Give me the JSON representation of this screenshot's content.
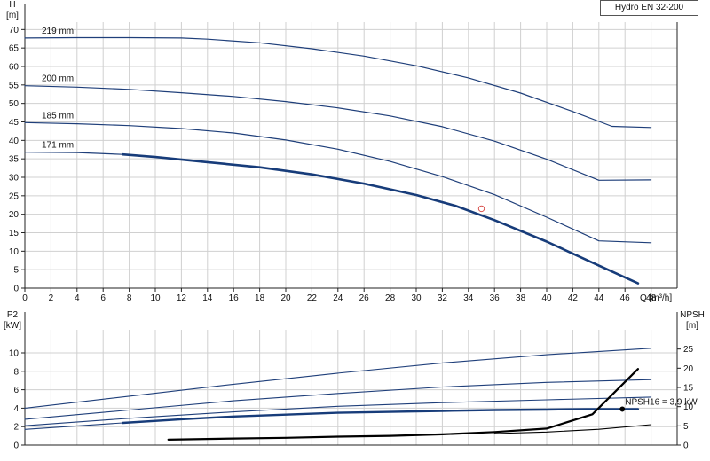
{
  "title": "Hydro EN 32-200",
  "chart_data": [
    {
      "type": "line",
      "xlabel": "Q [m³/h]",
      "ylabel_line1": "H",
      "ylabel_line2": "[m]",
      "xlim": [
        0,
        50
      ],
      "ylim": [
        0,
        72
      ],
      "xticks": [
        0,
        2,
        4,
        6,
        8,
        10,
        12,
        14,
        16,
        18,
        20,
        22,
        24,
        26,
        28,
        30,
        32,
        34,
        36,
        38,
        40,
        42,
        44,
        46,
        48
      ],
      "yticks": [
        0,
        5,
        10,
        15,
        20,
        25,
        30,
        35,
        40,
        45,
        50,
        55,
        60,
        65,
        70
      ],
      "grid": true,
      "series": [
        {
          "name": "219 mm",
          "color": "#1f3f7a",
          "width": 1.2,
          "x": [
            0,
            4,
            8,
            12,
            14,
            18,
            22,
            26,
            30,
            34,
            38,
            42,
            45,
            48
          ],
          "y": [
            67.7,
            67.8,
            67.8,
            67.7,
            67.4,
            66.4,
            64.8,
            62.8,
            60.2,
            56.9,
            52.8,
            47.8,
            43.8,
            43.5
          ]
        },
        {
          "name": "200 mm",
          "color": "#1f3f7a",
          "width": 1.2,
          "x": [
            0,
            4,
            8,
            12,
            16,
            20,
            24,
            28,
            32,
            36,
            40,
            44,
            48
          ],
          "y": [
            54.8,
            54.4,
            53.8,
            52.9,
            51.9,
            50.5,
            48.8,
            46.6,
            43.7,
            39.8,
            34.9,
            29.2,
            29.3
          ]
        },
        {
          "name": "185 mm",
          "color": "#1f3f7a",
          "width": 1.2,
          "x": [
            0,
            4,
            8,
            12,
            16,
            20,
            24,
            28,
            32,
            36,
            40,
            44,
            48
          ],
          "y": [
            44.8,
            44.5,
            44.0,
            43.2,
            42.0,
            40.1,
            37.6,
            34.3,
            30.2,
            25.3,
            19.2,
            12.8,
            12.3
          ]
        },
        {
          "name": "171 mm",
          "color": "#1f3f7a",
          "width": 1.2,
          "x": [
            0,
            4,
            7.5
          ],
          "y": [
            36.8,
            36.7,
            36.2
          ]
        },
        {
          "name": "171 mm duty",
          "color": "#173c7a",
          "width": 2.6,
          "x": [
            7.5,
            10,
            14,
            18,
            22,
            26,
            30,
            33,
            36,
            40,
            44,
            47
          ],
          "y": [
            36.2,
            35.5,
            34.1,
            32.7,
            30.8,
            28.3,
            25.2,
            22.3,
            18.4,
            12.6,
            6.1,
            1.3
          ]
        }
      ],
      "point": {
        "x": 35,
        "y": 21.5,
        "color": "#d9534f"
      }
    },
    {
      "type": "line",
      "ylabel_left_line1": "P2",
      "ylabel_left_line2": "[kW]",
      "ylabel_right_line1": "NPSH",
      "ylabel_right_line2": "[m]",
      "xlim": [
        0,
        50
      ],
      "ylim_left": [
        0,
        12.5
      ],
      "ylim_right": [
        0,
        30
      ],
      "yticks_left": [
        0,
        2,
        4,
        6,
        8,
        10
      ],
      "yticks_right": [
        0,
        5,
        10,
        15,
        20,
        25
      ],
      "grid": true,
      "series": [
        {
          "name": "P2 219",
          "color": "#1f3f7a",
          "width": 1.1,
          "axis": "left",
          "x": [
            0,
            8,
            16,
            24,
            32,
            40,
            48
          ],
          "y": [
            4.0,
            5.3,
            6.6,
            7.8,
            8.9,
            9.8,
            10.5
          ]
        },
        {
          "name": "P2 200",
          "color": "#1f3f7a",
          "width": 1.1,
          "axis": "left",
          "x": [
            0,
            8,
            16,
            24,
            32,
            40,
            48
          ],
          "y": [
            2.8,
            3.8,
            4.8,
            5.6,
            6.3,
            6.8,
            7.1
          ]
        },
        {
          "name": "P2 185",
          "color": "#1f3f7a",
          "width": 1.1,
          "axis": "left",
          "x": [
            0,
            8,
            16,
            24,
            32,
            40,
            48
          ],
          "y": [
            2.1,
            2.9,
            3.6,
            4.2,
            4.6,
            4.9,
            5.2
          ]
        },
        {
          "name": "P2 171",
          "color": "#1f3f7a",
          "width": 1.1,
          "axis": "left",
          "x": [
            0,
            7.5
          ],
          "y": [
            1.7,
            2.4
          ]
        },
        {
          "name": "P2 171 duty",
          "color": "#173c7a",
          "width": 2.4,
          "axis": "left",
          "x": [
            7.5,
            12,
            16,
            20,
            24,
            28,
            32,
            36,
            40,
            43,
            47
          ],
          "y": [
            2.4,
            2.8,
            3.1,
            3.3,
            3.5,
            3.6,
            3.7,
            3.8,
            3.85,
            3.9,
            3.9
          ]
        },
        {
          "name": "NPSH 171",
          "color": "#000000",
          "width": 2.2,
          "axis": "right",
          "x": [
            11,
            16,
            20,
            24,
            28,
            32,
            36,
            40,
            43.5,
            47
          ],
          "y": [
            1.4,
            1.7,
            1.9,
            2.2,
            2.4,
            2.8,
            3.4,
            4.3,
            8.0,
            19.8
          ]
        },
        {
          "name": "NPSH other",
          "color": "#000000",
          "width": 1.1,
          "axis": "right",
          "x": [
            36,
            40,
            44,
            48
          ],
          "y": [
            3.0,
            3.4,
            4.1,
            5.3
          ]
        }
      ],
      "point": {
        "x": 45.8,
        "y": 3.9,
        "axis": "left",
        "color": "#000000"
      },
      "annotation": "NPSH16 = 3,9 kW"
    }
  ]
}
